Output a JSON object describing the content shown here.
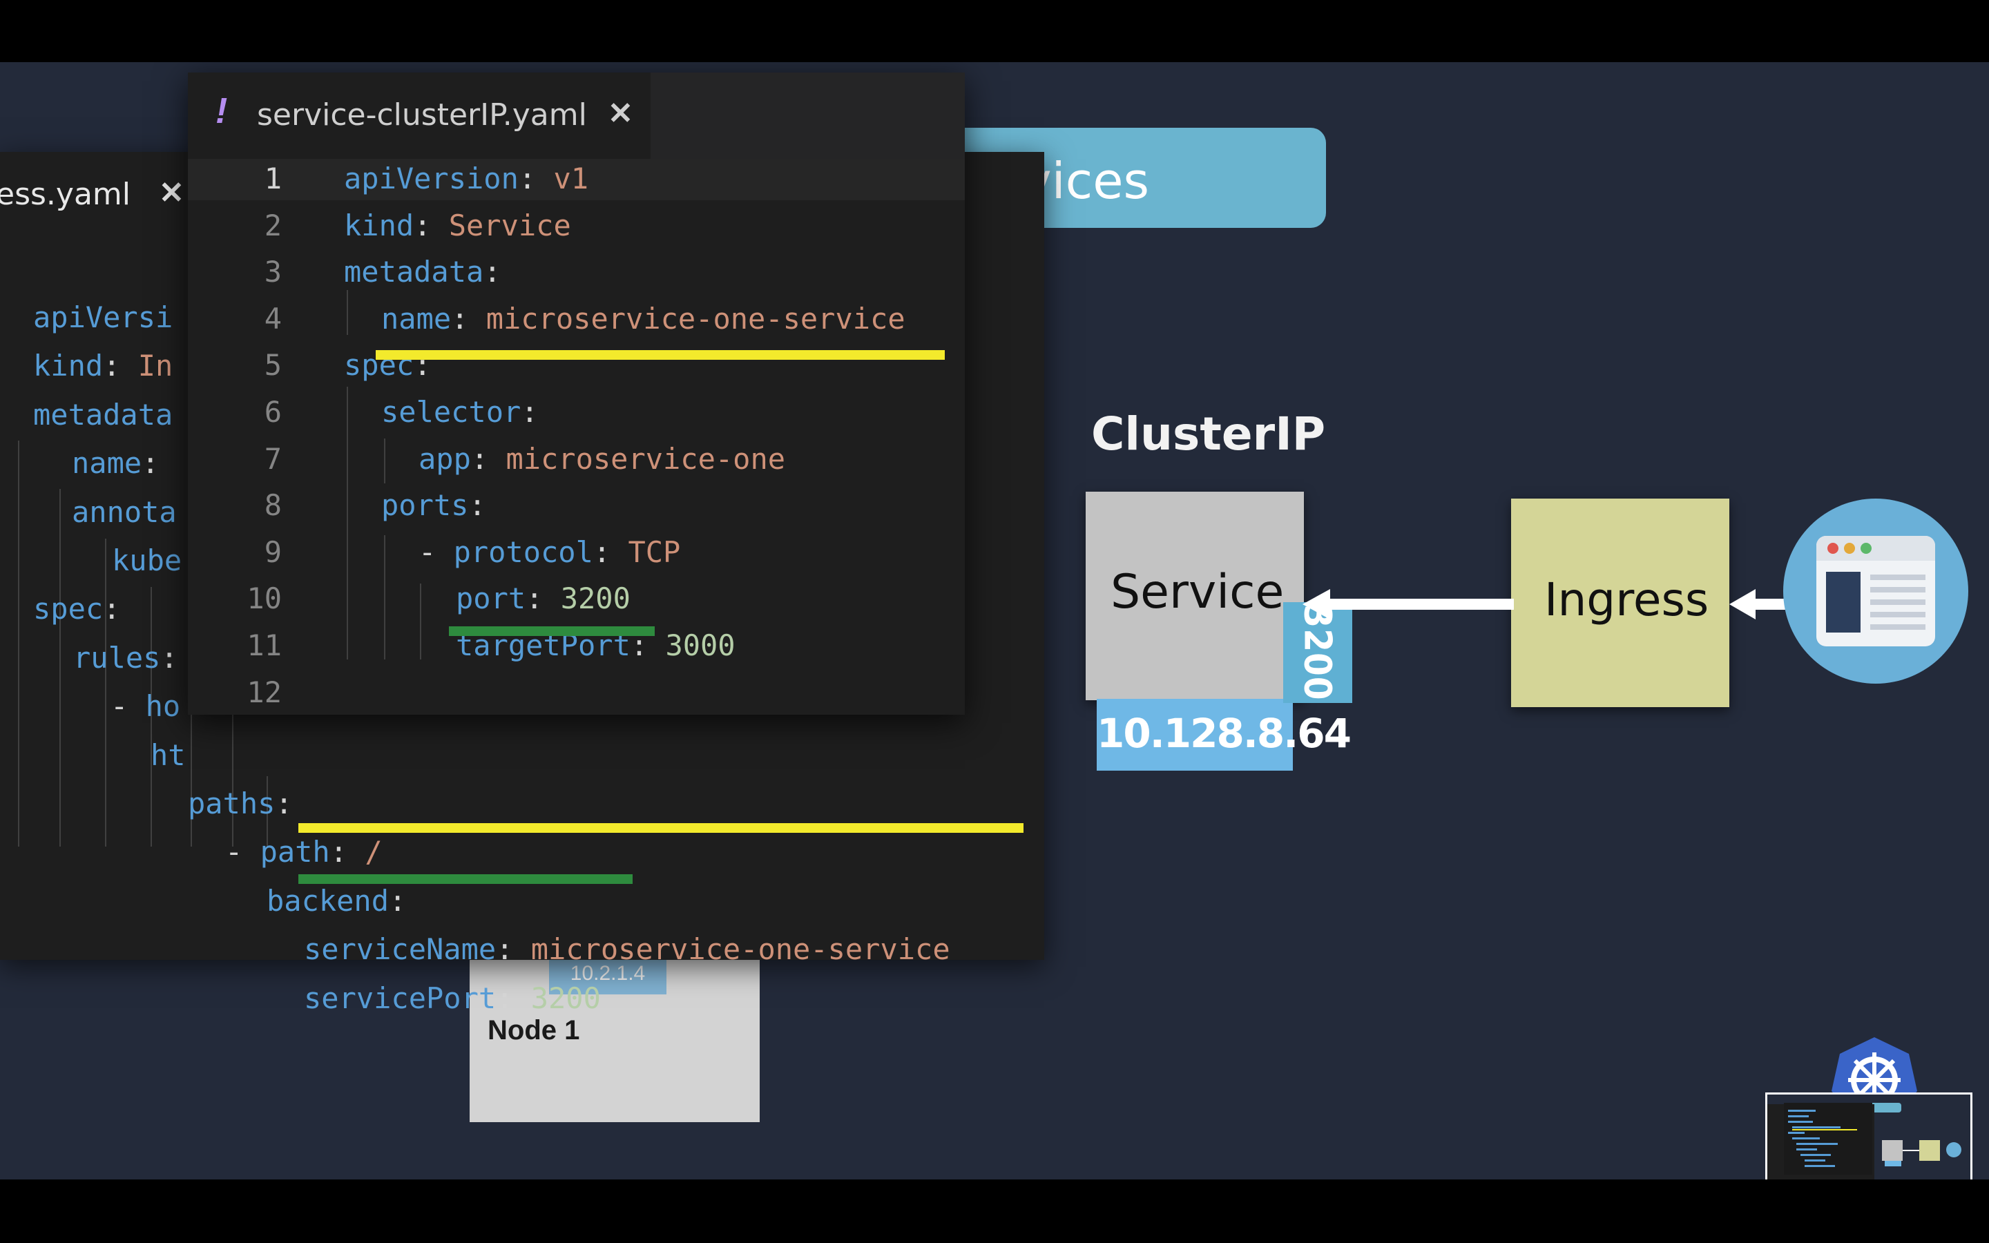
{
  "banner": {
    "text": "vices"
  },
  "node": {
    "label": "Node 1",
    "ip": "10.2.1.4"
  },
  "back_editor": {
    "tab": {
      "label": "ess.yaml",
      "close_glyph": "✕"
    },
    "lines": [
      {
        "key": "apiVersi",
        "sep": "",
        "val": ""
      },
      {
        "key": "kind",
        "sep": ": ",
        "val": "In"
      },
      {
        "key": "metadata",
        "sep": "",
        "val": ""
      },
      {
        "key": "name",
        "sep": ":",
        "val": ""
      },
      {
        "key": "annota",
        "sep": "",
        "val": ""
      },
      {
        "key": "kube",
        "sep": "",
        "val": ""
      },
      {
        "key": "spec",
        "sep": ":",
        "val": ""
      },
      {
        "key": "rules",
        "sep": ":",
        "val": ""
      },
      {
        "dash": "- ",
        "key": "ho",
        "sep": "",
        "val": ""
      },
      {
        "key": "ht",
        "sep": "",
        "val": ""
      },
      {
        "key": "paths",
        "sep": ":",
        "val": ""
      },
      {
        "dash": "- ",
        "key": "path",
        "sep": ": ",
        "val": "/"
      },
      {
        "key": "backend",
        "sep": ":",
        "val": ""
      },
      {
        "key": "serviceName",
        "sep": ": ",
        "val": "microservice-one-service"
      },
      {
        "key": "servicePort",
        "sep": ": ",
        "val": "3200"
      }
    ]
  },
  "front_editor": {
    "tab": {
      "bang": "!",
      "label": "service-clusterIP.yaml",
      "close_glyph": "✕"
    },
    "line_numbers": [
      "1",
      "2",
      "3",
      "4",
      "5",
      "6",
      "7",
      "8",
      "9",
      "10",
      "11",
      "12"
    ],
    "lines": [
      {
        "key": "apiVersion",
        "sep": ": ",
        "val": "v1"
      },
      {
        "key": "kind",
        "sep": ": ",
        "val": "Service"
      },
      {
        "key": "metadata",
        "sep": ":",
        "val": ""
      },
      {
        "key": "name",
        "sep": ": ",
        "val": "microservice-one-service"
      },
      {
        "key": "spec",
        "sep": ":",
        "val": ""
      },
      {
        "key": "selector",
        "sep": ":",
        "val": ""
      },
      {
        "key": "app",
        "sep": ": ",
        "val": "microservice-one"
      },
      {
        "key": "ports",
        "sep": ":",
        "val": ""
      },
      {
        "dash": "- ",
        "key": "protocol",
        "sep": ": ",
        "val": "TCP"
      },
      {
        "key": "port",
        "sep": ": ",
        "val": "3200"
      },
      {
        "key": "targetPort",
        "sep": ": ",
        "val": "3000"
      },
      {
        "key": "",
        "sep": "",
        "val": ""
      }
    ]
  },
  "diagram": {
    "title": "ClusterIP",
    "service_label": "Service",
    "service_port": "3200",
    "service_ip": "10.128.8.64",
    "ingress_label": "Ingress",
    "browser_icon": "browser-window-icon",
    "k8s_icon": "kubernetes-helm-icon"
  },
  "colors": {
    "stage_bg": "#232a3a",
    "editor_bg": "#1e1e1e",
    "yaml_key": "#569cd6",
    "yaml_string": "#ce9178",
    "yaml_number": "#b5cea8",
    "highlight_yellow": "#f3ea2c",
    "highlight_green": "#2e8b3e",
    "service_box": "#c3c3c3",
    "ingress_box": "#d4d597",
    "port_tag": "#5fb0d3",
    "ip_tag": "#6fb8e6"
  }
}
